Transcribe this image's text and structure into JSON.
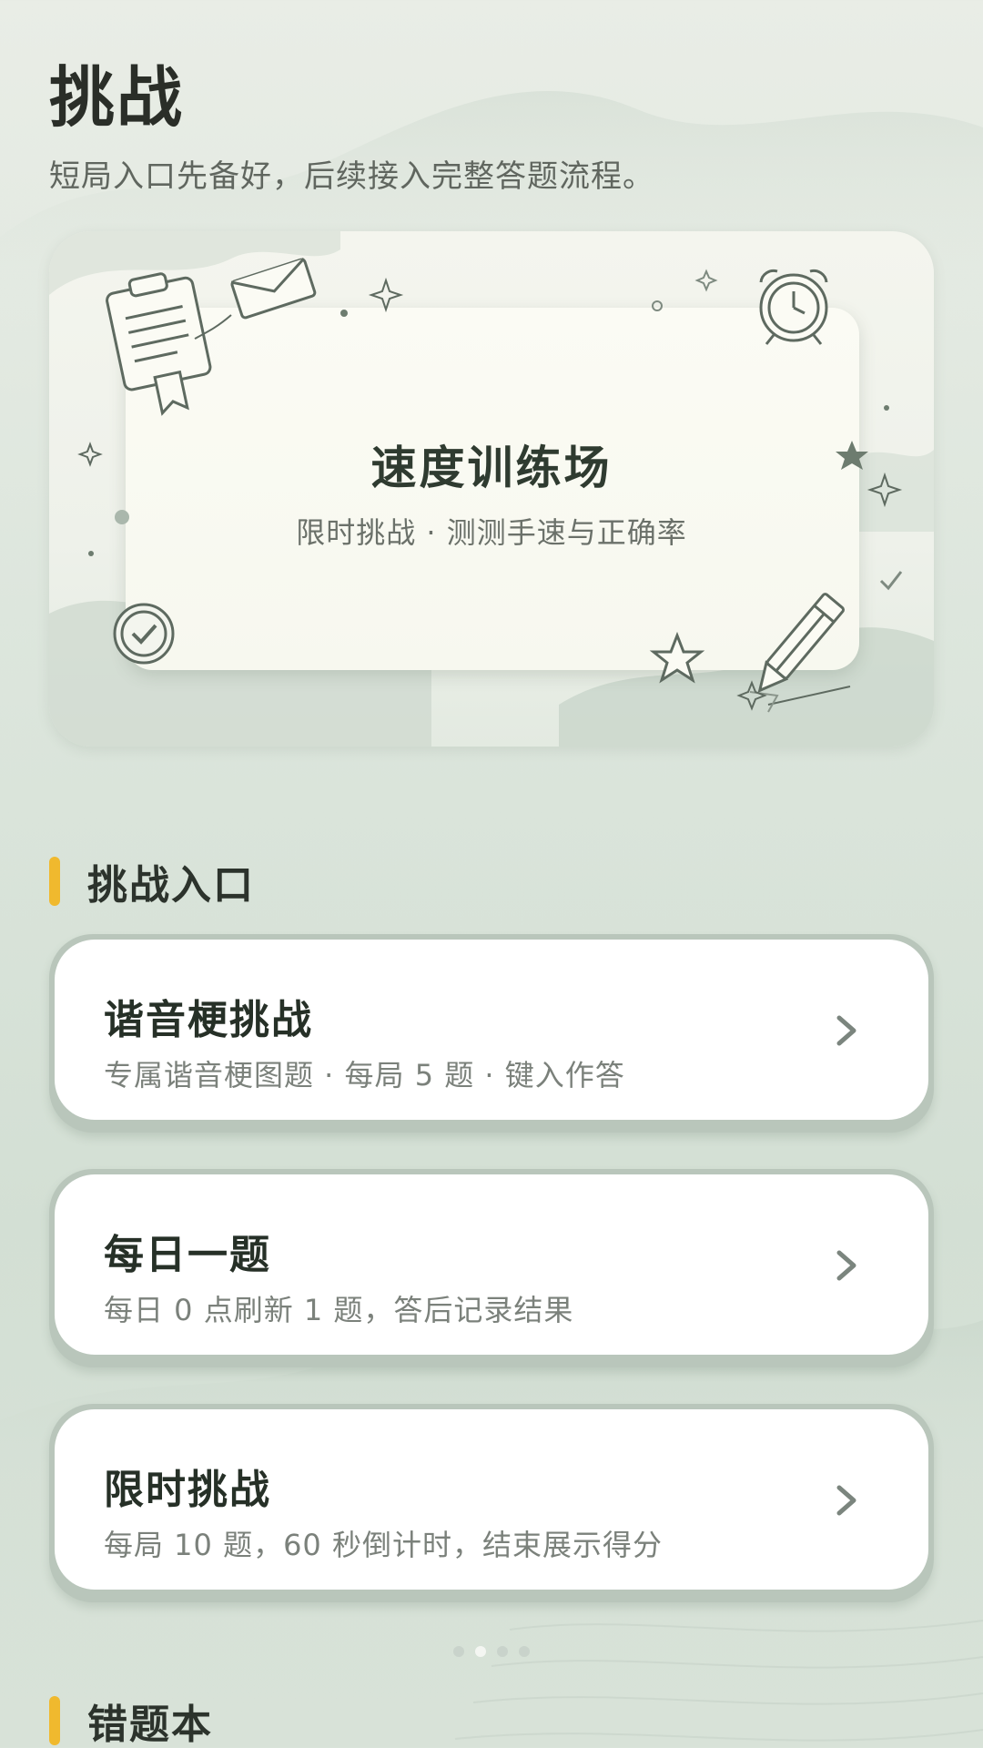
{
  "header": {
    "title": "挑战",
    "subtitle": "短局入口先备好，后续接入完整答题流程。"
  },
  "hero": {
    "title": "速度训练场",
    "subtitle": "限时挑战 · 测测手速与正确率"
  },
  "sections": {
    "entries_title": "挑战入口",
    "wrongbook_title": "错题本"
  },
  "entries": [
    {
      "title": "谐音梗挑战",
      "desc": "专属谐音梗图题 · 每局 5 题 · 键入作答"
    },
    {
      "title": "每日一题",
      "desc": "每日 0 点刷新 1 题，答后记录结果"
    },
    {
      "title": "限时挑战",
      "desc": "每局 10 题，60 秒倒计时，结束展示得分"
    }
  ],
  "pagination": {
    "count": 4,
    "active_index": 1
  },
  "colors": {
    "accent": "#f0b92e",
    "text_primary": "#263027",
    "text_secondary": "#7b817b"
  },
  "icons": [
    "clipboard-icon",
    "envelope-icon",
    "alarm-clock-icon",
    "check-circle-icon",
    "star-icon",
    "pencil-icon",
    "sparkle-icon",
    "chevron-right-icon"
  ]
}
